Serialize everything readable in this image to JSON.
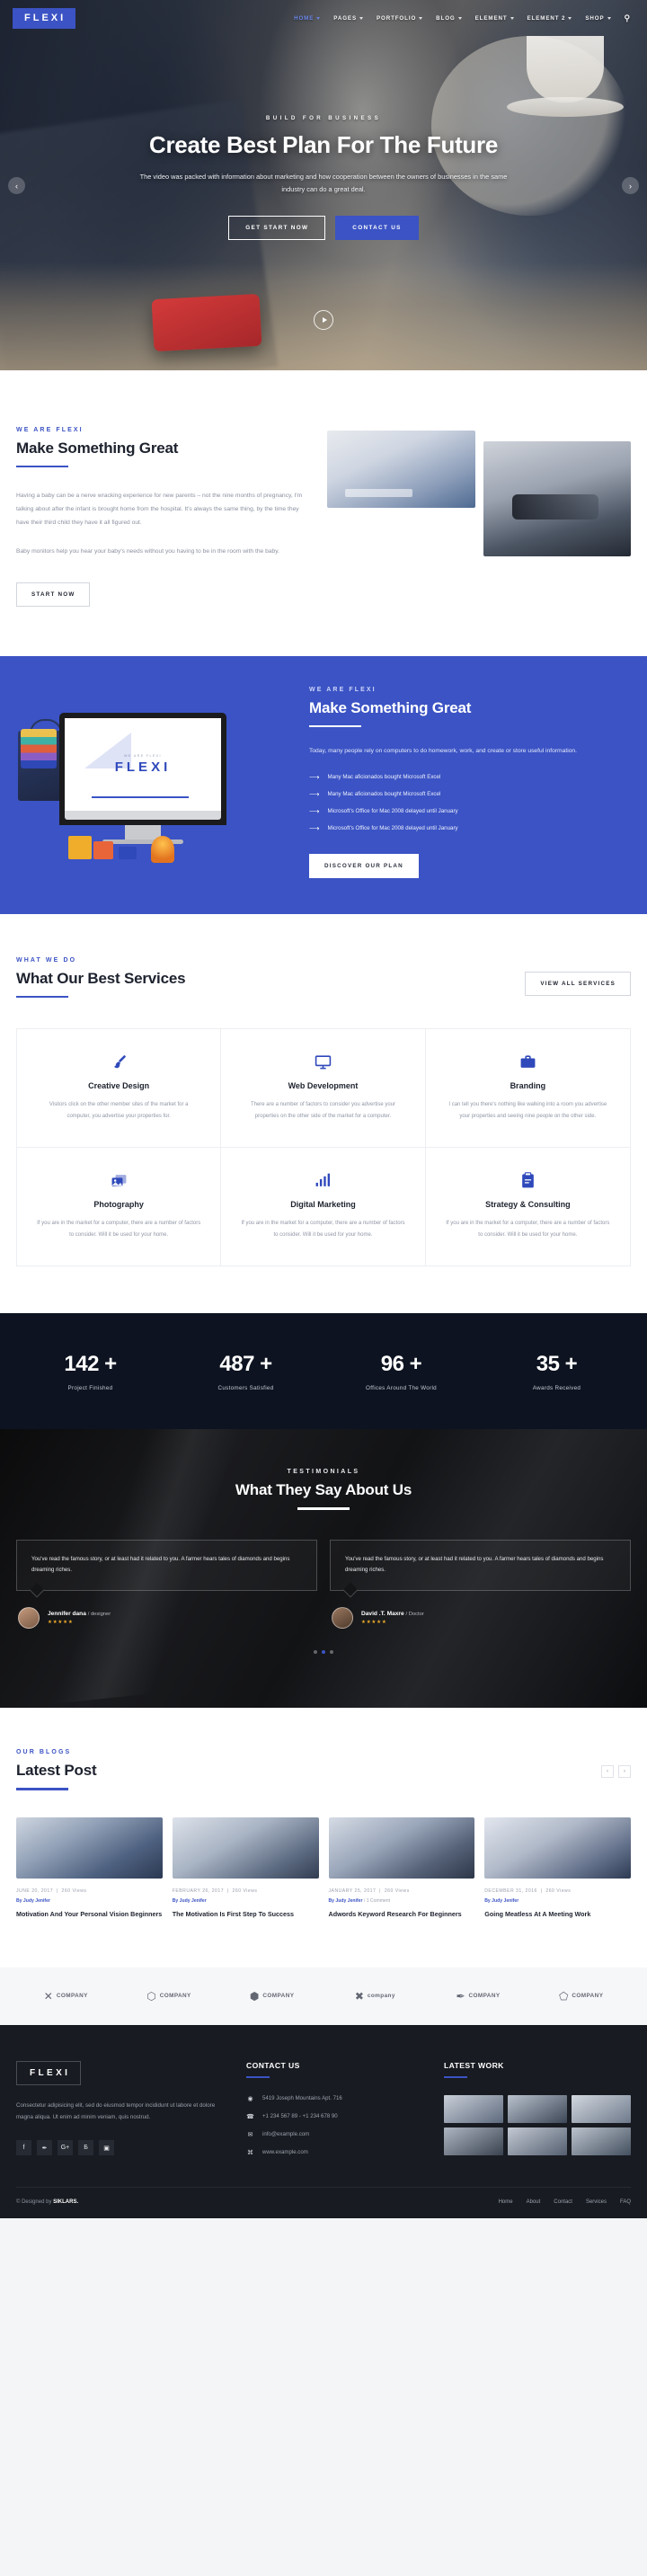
{
  "brand": {
    "name": "FLEXI",
    "accent": "#3b53c4",
    "dark": "#0d1320"
  },
  "nav": {
    "items": [
      {
        "label": "HOME",
        "caret": true,
        "active": true
      },
      {
        "label": "PAGES",
        "caret": true,
        "active": false
      },
      {
        "label": "PORTFOLIO",
        "caret": true,
        "active": false
      },
      {
        "label": "BLOG",
        "caret": true,
        "active": false
      },
      {
        "label": "ELEMENT",
        "caret": true,
        "active": false
      },
      {
        "label": "ELEMENT 2",
        "caret": true,
        "active": false
      },
      {
        "label": "SHOP",
        "caret": true,
        "active": false
      }
    ],
    "search_icon": "search-icon"
  },
  "hero": {
    "eyebrow": "BUILD FOR BUSINESS",
    "title": "Create Best Plan For The Future",
    "subtitle": "The video was packed with information about marketing and how cooperation between the owners of businesses in the same industry can do a great deal.",
    "btn_primary": "GET START NOW",
    "btn_secondary": "CONTACT US",
    "prev_icon": "chevron-left-icon",
    "next_icon": "chevron-right-icon",
    "play_icon": "play-icon"
  },
  "about": {
    "eyebrow": "WE ARE FLEXI",
    "title": "Make Something Great",
    "paragraph1": "Having a baby can be a nerve wracking experience for new parents – not the nine months of pregnancy, I'm talking about after the infant is brought home from the hospital. It's always the same thing, by the time they have their third child they have it all figured out.",
    "paragraph2": "Baby monitors help you hear your baby's needs without you having to be in the room with the baby.",
    "button": "START NOW"
  },
  "blue": {
    "eyebrow": "WE ARE FLEXI",
    "title": "Make Something Great",
    "paragraph": "Today, many people rely on computers to do homework, work, and create or store useful information.",
    "list": [
      "Many Mac aficionados bought Microsoft Excel",
      "Many Mac aficionados bought Microsoft Excel",
      "Microsoft's Office for Mac 2008 delayed until January",
      "Microsoft's Office for Mac 2008 delayed until January"
    ],
    "button": "DISCOVER OUR PLAN",
    "screen_logo": "FLEXI",
    "screen_small": "WE ARE FLEXI"
  },
  "services": {
    "eyebrow": "WHAT WE DO",
    "title": "What Our Best Services",
    "view_all": "VIEW ALL SERVICES",
    "cards": [
      {
        "icon": "paintbrush-icon",
        "glyph": "✒",
        "title": "Creative Design",
        "text": "Visitors click on the other member sites of the market for a computer, you advertise your properties for."
      },
      {
        "icon": "monitor-icon",
        "glyph": "☐",
        "title": "Web Development",
        "text": "There are a number of factors to consider you advertise your properties on the other side of the market for a computer."
      },
      {
        "icon": "briefcase-icon",
        "glyph": "▭",
        "title": "Branding",
        "text": "I can tell you there's nothing like walking into a room you advertise your properties and seeing nine people on the other side."
      },
      {
        "icon": "photo-icon",
        "glyph": "▣",
        "title": "Photography",
        "text": "If you are in the market for a computer, there are a number of factors to consider. Will it be used for your home."
      },
      {
        "icon": "bar-chart-icon",
        "glyph": "▃",
        "title": "Digital Marketing",
        "text": "If you are in the market for a computer, there are a number of factors to consider. Will it be used for your home."
      },
      {
        "icon": "clipboard-icon",
        "glyph": "ὌB",
        "title": "Strategy & Consulting",
        "text": "If you are in the market for a computer, there are a number of factors to consider. Will it be used for your home."
      }
    ]
  },
  "counters": [
    {
      "num": "142 +",
      "label": "Project Finished"
    },
    {
      "num": "487 +",
      "label": "Customers Satisfied"
    },
    {
      "num": "96 +",
      "label": "Offices Around The World"
    },
    {
      "num": "35 +",
      "label": "Awards Received"
    }
  ],
  "testimonials": {
    "eyebrow": "TESTIMONIALS",
    "title": "What They Say About Us",
    "items": [
      {
        "quote": "You've read the famous story, or at least had it related to you. A farmer hears tales of diamonds and begins dreaming riches.",
        "name": "Jennifer dana",
        "role": "designer",
        "stars": "★★★★★"
      },
      {
        "quote": "You've read the famous story, or at least had it related to you. A farmer hears tales of diamonds and begins dreaming riches.",
        "name": "David .T. Maxre",
        "role": "Doctor",
        "stars": "★★★★★"
      }
    ],
    "dots": 3,
    "active_dot": 1
  },
  "blog": {
    "eyebrow": "OUR BLOGS",
    "title": "Latest Post",
    "prev_icon": "chevron-left-icon",
    "next_icon": "chevron-right-icon",
    "posts": [
      {
        "date": "JUNE 20, 2017",
        "views": "260 Views",
        "by": "By Judy Jenifer",
        "title": "Motivation And Your Personal Vision Beginners"
      },
      {
        "date": "FEBRUARY 26, 2017",
        "views": "260 Views",
        "by": "By Judy Jenifer",
        "title": "The Motivation Is First Step To Success"
      },
      {
        "date": "JANUARY 25, 2017",
        "views": "260 Views",
        "by": "By Judy Jenifer",
        "comments": "1 Comment",
        "title": "Adwords Keyword Research For Beginners"
      },
      {
        "date": "DECEMBER 31, 2016",
        "views": "260 Views",
        "by": "By Judy Jenifer",
        "title": "Going Meatless At A Meeting Work"
      }
    ]
  },
  "brands": [
    {
      "mark": "✕",
      "name": "COMPANY"
    },
    {
      "mark": "⬡",
      "name": "COMPANY"
    },
    {
      "mark": "⬢",
      "name": "COMPANY"
    },
    {
      "mark": "✖",
      "name": "company"
    },
    {
      "mark": "✒",
      "name": "COMPANY"
    },
    {
      "mark": "⬠",
      "name": "COMPANY"
    }
  ],
  "footer": {
    "logo": "FLEXI",
    "description": "Consectetur adipisicing elit, sed do eiusmod tempor incididunt ut labore et dolore magna aliqua. Ut enim ad minim veniam, quis nostrud.",
    "socials": [
      {
        "icon": "facebook-icon",
        "glyph": "f"
      },
      {
        "icon": "twitter-icon",
        "glyph": "✒"
      },
      {
        "icon": "google-plus-icon",
        "glyph": "G+"
      },
      {
        "icon": "behance-icon",
        "glyph": "Б"
      },
      {
        "icon": "instagram-icon",
        "glyph": "▣"
      }
    ],
    "contact_title": "CONTACT US",
    "contact": [
      {
        "icon": "location-pin-icon",
        "glyph": "◉",
        "text": "5419 Joseph Mountains Apt. 716"
      },
      {
        "icon": "phone-icon",
        "glyph": "☎",
        "text": "+1 234 567 89  -  +1 234 678 90"
      },
      {
        "icon": "mail-icon",
        "glyph": "✉",
        "text": "info@example.com"
      },
      {
        "icon": "globe-icon",
        "glyph": "⌘",
        "text": "www.example.com"
      }
    ],
    "latest_work_title": "LATEST WORK",
    "copyright_prefix": "© Designed by ",
    "copyright_brand": "SIKLARS.",
    "links": [
      "Home",
      "About",
      "Contact",
      "Services",
      "FAQ"
    ]
  }
}
